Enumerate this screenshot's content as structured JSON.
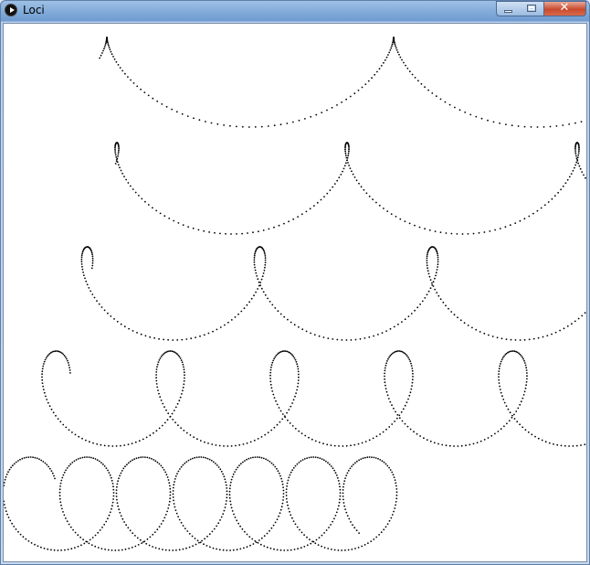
{
  "window": {
    "title": "Loci"
  },
  "controls": {
    "minimize_icon": "minimize-icon",
    "maximize_icon": "maximize-icon",
    "close_glyph": "✕"
  },
  "app_icon": "play-circle-icon",
  "canvas": {
    "background": "#ffffff",
    "dot_color": "#000000",
    "rows": 5
  }
}
